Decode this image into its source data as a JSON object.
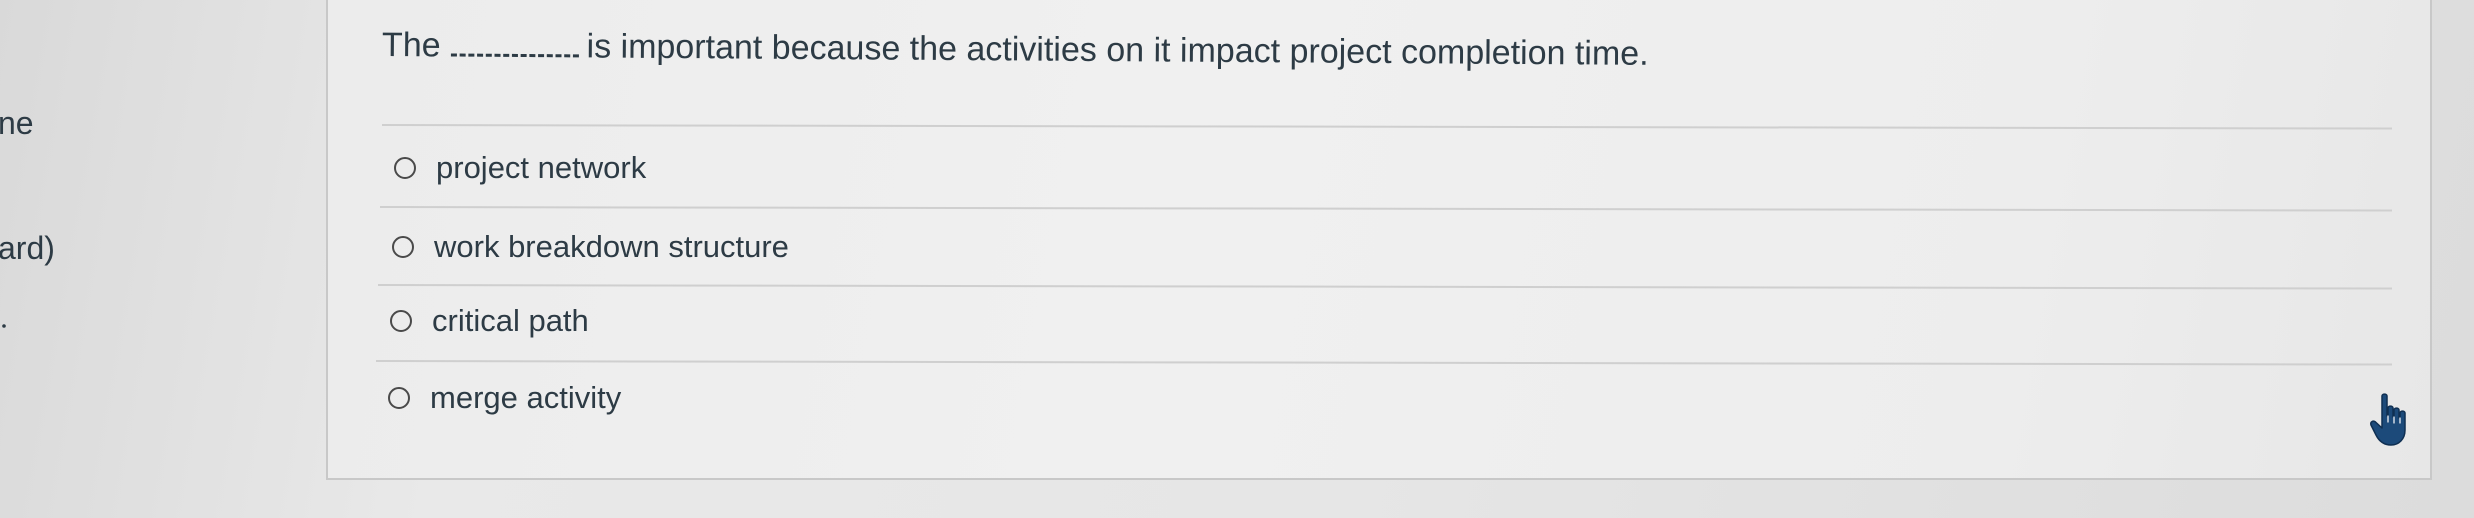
{
  "sidebar_fragments": {
    "frag1": "ne",
    "frag2": "ard)"
  },
  "question": {
    "prefix": "The",
    "suffix": "is important because the activities on it impact project completion time."
  },
  "options": [
    {
      "label": "project network"
    },
    {
      "label": "work breakdown structure"
    },
    {
      "label": "critical path"
    },
    {
      "label": "merge activity"
    }
  ],
  "cursor": {
    "icon": "hand-pointer-icon",
    "color": "#1c4a7a"
  }
}
